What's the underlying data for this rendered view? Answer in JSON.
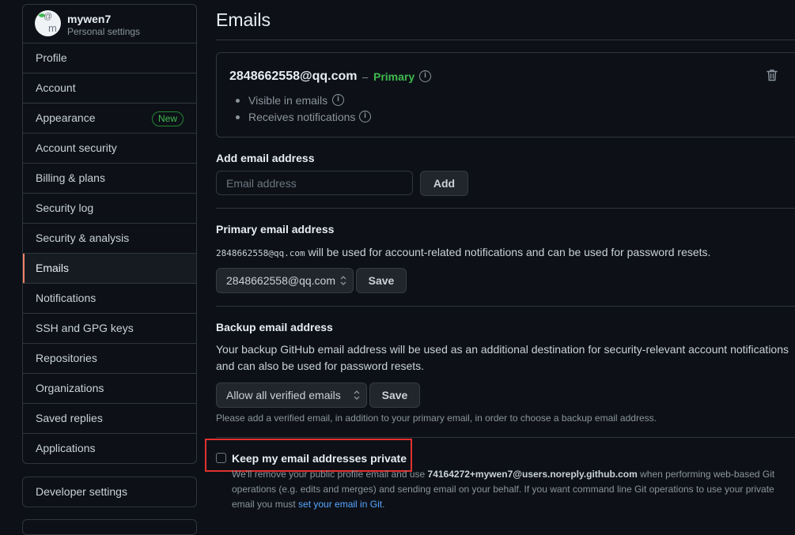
{
  "sidebar": {
    "user": {
      "name": "mywen7",
      "subtitle": "Personal settings"
    },
    "items": [
      {
        "label": "Profile"
      },
      {
        "label": "Account"
      },
      {
        "label": "Appearance",
        "badge": "New"
      },
      {
        "label": "Account security"
      },
      {
        "label": "Billing & plans"
      },
      {
        "label": "Security log"
      },
      {
        "label": "Security & analysis"
      },
      {
        "label": "Emails",
        "active": true
      },
      {
        "label": "Notifications"
      },
      {
        "label": "SSH and GPG keys"
      },
      {
        "label": "Repositories"
      },
      {
        "label": "Organizations"
      },
      {
        "label": "Saved replies"
      },
      {
        "label": "Applications"
      }
    ],
    "developer_settings": "Developer settings"
  },
  "main": {
    "title": "Emails",
    "email_card": {
      "address": "2848662558@qq.com",
      "separator": "–",
      "primary_label": "Primary",
      "bullets": [
        "Visible in emails",
        "Receives notifications"
      ]
    },
    "add_email": {
      "label": "Add email address",
      "placeholder": "Email address",
      "button": "Add"
    },
    "primary_email": {
      "label": "Primary email address",
      "desc_email": "2848662558@qq.com",
      "desc_text": " will be used for account-related notifications and can be used for password resets.",
      "selected": "2848662558@qq.com",
      "button": "Save"
    },
    "backup_email": {
      "label": "Backup email address",
      "desc": "Your backup GitHub email address will be used as an additional destination for security-relevant account notifications and can also be used for password resets.",
      "selected": "Allow all verified emails",
      "button": "Save",
      "note": "Please add a verified email, in addition to your primary email, in order to choose a backup email address."
    },
    "keep_private": {
      "label": "Keep my email addresses private",
      "checked": false,
      "desc_1": "We'll remove your public profile email and use ",
      "noreply": "74164272+mywen7@users.noreply.github.com",
      "desc_2": " when performing web-based Git operations (e.g. edits and merges) and sending email on your behalf. If you want command line Git operations to use your private email you must ",
      "link": "set your email in Git",
      "desc_3": "."
    }
  },
  "colors": {
    "background": "#0d1117",
    "border": "#30363d",
    "accent_active": "#f78166",
    "primary_green": "#3fb950",
    "link_blue": "#58a6ff",
    "highlight_red": "#e0312e"
  }
}
